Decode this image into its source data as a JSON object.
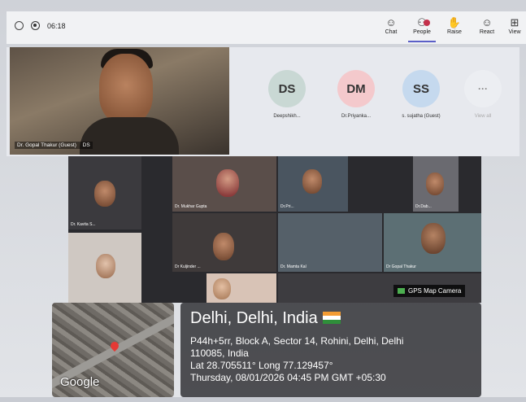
{
  "toolbar": {
    "timer": "06:18",
    "items": [
      {
        "label": "Chat",
        "glyph": "☺"
      },
      {
        "label": "People",
        "glyph": "⚇"
      },
      {
        "label": "Raise",
        "glyph": "✋"
      },
      {
        "label": "React",
        "glyph": "☺"
      },
      {
        "label": "View",
        "glyph": "⊞"
      }
    ]
  },
  "gallery": {
    "main_name": "Dr. Gopal Thakur (Guest)",
    "main_badge": "DS",
    "avatars": [
      {
        "initials": "DS",
        "label": "Deepshikh...",
        "color": "#c9d8d4"
      },
      {
        "initials": "DM",
        "label": "Dr.Priyanka...",
        "color": "#f4c9cc"
      },
      {
        "initials": "SS",
        "label": "s. sujatha (Guest)",
        "color": "#c5d9ee"
      }
    ],
    "more_glyph": "···",
    "more_label": "View all"
  },
  "grid_names": [
    "Dr. Mukhar Gupta",
    "Dr.Pri...",
    "Dr.Dab...",
    "Dr. Kavita S...",
    "Dr Kuljinder ...",
    "Dr. Mamta Kal",
    "Dr Gopal Thakur"
  ],
  "gps": {
    "tag": "GPS Map Camera",
    "city": "Delhi, Delhi, India",
    "address_line1": "P44h+5rr, Block A, Sector 14, Rohini, Delhi, Delhi",
    "address_line2": "110085, India",
    "latlong": "Lat 28.705511° Long 77.129457°",
    "datetime": "Thursday, 08/01/2026 04:45 PM GMT +05:30",
    "map_logo": "Google"
  }
}
